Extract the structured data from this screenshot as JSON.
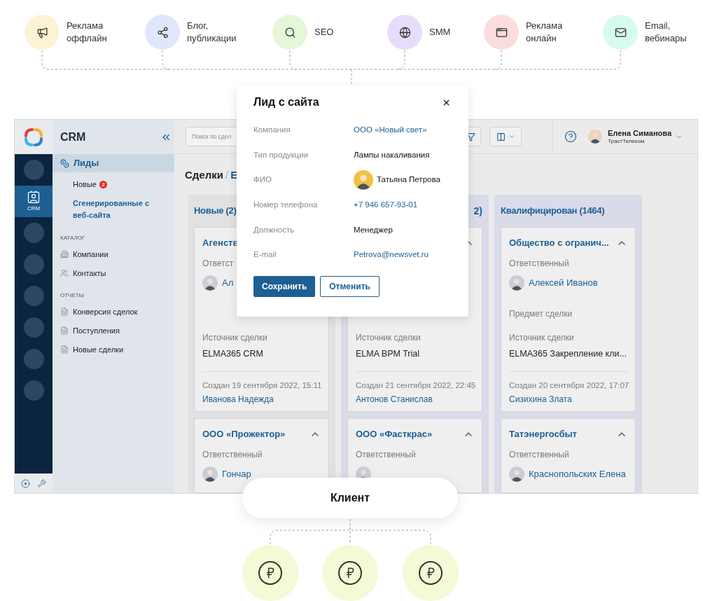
{
  "channels": [
    {
      "lines": [
        "Реклама",
        "оффлайн"
      ],
      "kind": "megaphone",
      "color": "#fbf3d4"
    },
    {
      "lines": [
        "Блог,",
        "публикации"
      ],
      "kind": "nodes",
      "color": "#dfe8fb"
    },
    {
      "lines": [
        "SEO"
      ],
      "kind": "search",
      "color": "#e4f8d9"
    },
    {
      "lines": [
        "SMM"
      ],
      "kind": "globe",
      "color": "#e8dcfb"
    },
    {
      "lines": [
        "Реклама",
        "онлайн"
      ],
      "kind": "browser",
      "color": "#fcdcdc"
    },
    {
      "lines": [
        "Email,",
        "вебинары"
      ],
      "kind": "mail",
      "color": "#d8fbf0"
    }
  ],
  "app": {
    "rail": [
      {
        "kind": "placeholder",
        "selected": false
      },
      {
        "kind": "crm",
        "label": "CRM",
        "selected": true
      },
      {
        "kind": "placeholder",
        "selected": false
      },
      {
        "kind": "placeholder",
        "selected": false
      },
      {
        "kind": "placeholder",
        "selected": false
      },
      {
        "kind": "placeholder",
        "selected": false
      },
      {
        "kind": "placeholder",
        "selected": false
      },
      {
        "kind": "placeholder",
        "selected": false
      }
    ],
    "sidebar": {
      "title": "CRM",
      "group": {
        "label": "Лиды",
        "selected": true
      },
      "subitems": [
        {
          "label": "Новые",
          "badge": "2",
          "selected": false
        },
        {
          "label": "Сгенерированные с веб-сайта",
          "selected": true
        }
      ],
      "sections": [
        {
          "heading": "КАТАЛОГ",
          "items": [
            {
              "label": "Компании",
              "kind": "building"
            },
            {
              "label": "Контакты",
              "kind": "people"
            }
          ]
        },
        {
          "heading": "ОТЧЕТЫ",
          "items": [
            {
              "label": "Конверсия сделок",
              "kind": "report"
            },
            {
              "label": "Поступления",
              "kind": "report"
            },
            {
              "label": "Новые сделки",
              "kind": "report"
            }
          ]
        }
      ]
    },
    "header": {
      "search_placeholder": "Поиск по сдел",
      "user": {
        "name": "Елена Симанова",
        "company": "ТрастТелеком"
      }
    },
    "breadcrumb": [
      {
        "text": "Сделки",
        "kind": "current"
      },
      {
        "text": "/",
        "kind": "separator"
      },
      {
        "text": "Е",
        "kind": "link"
      }
    ],
    "columns": [
      {
        "title": "Новые (2)",
        "color": "#e1e1e3",
        "cards": [
          {
            "title": "Агенств",
            "responsible_label": "Ответст",
            "responsible": {
              "avatar": true,
              "name": "Ал"
            },
            "source_label": "Источник сделки",
            "source": "ELMA365 CRM",
            "created": "Создан 19 сентября 2022, 15:11",
            "author": "Иванова Надежда"
          },
          {
            "title": "ООО «Прожектор»",
            "expanded": true,
            "responsible_label": "Ответственный",
            "responsible": {
              "avatar": true,
              "name": "Гончар"
            }
          }
        ]
      },
      {
        "title_tail": "2)",
        "color": "#d9dbe9",
        "cards": [
          {
            "expanded": true,
            "source_label": "Источник сделки",
            "source": "ELMA BPM Trial",
            "created": "Создан 21 сентября 2022, 22:45",
            "author": "Антонов Станислав"
          },
          {
            "title": "ООО «Фасткрас»",
            "expanded": true,
            "responsible_label": "Ответственный",
            "responsible": {
              "avatar": true
            }
          }
        ]
      },
      {
        "title": "Квалифицирован (1464)",
        "color": "#d9dbe9",
        "cards": [
          {
            "title": "Общество с огранич...",
            "expanded": true,
            "responsible_label": "Ответственный",
            "responsible": {
              "avatar": true,
              "name": "Алексей Иванов"
            },
            "subject_label": "Предмет сделки",
            "source_label": "Источник сделки",
            "source": "ELMA365 Закрепление кли...",
            "created": "Создан 20 сентября 2022, 17:07",
            "author": "Сизихина Злата"
          },
          {
            "title": "Татэнергосбыт",
            "expanded": true,
            "responsible_label": "Ответственный",
            "responsible": {
              "avatar": true,
              "name": "Краснопольских Елена"
            }
          }
        ]
      }
    ]
  },
  "dialog": {
    "title": "Лид с сайта",
    "fields": [
      {
        "label": "Компания",
        "value": "ООО «Новый свет»",
        "kind": "link"
      },
      {
        "label": "Тип продукции",
        "value": "Лампы накаливания",
        "kind": "text"
      },
      {
        "label": "ФИО",
        "value": "Татьяна Петрова",
        "kind": "person"
      },
      {
        "label": "Номер телефона",
        "value": "+7 946 657-93-01",
        "kind": "link"
      },
      {
        "label": "Должность",
        "value": "Менеджер",
        "kind": "text"
      },
      {
        "label": "E-mail",
        "value": "Petrova@newsvet.ru",
        "kind": "link"
      }
    ],
    "buttons": [
      {
        "label": "Сохранить",
        "kind": "primary"
      },
      {
        "label": "Отменить",
        "kind": "secondary"
      }
    ]
  },
  "client": {
    "label": "Клиент"
  },
  "payments": [
    {
      "kind": "ruble"
    },
    {
      "kind": "ruble"
    },
    {
      "kind": "ruble"
    }
  ]
}
